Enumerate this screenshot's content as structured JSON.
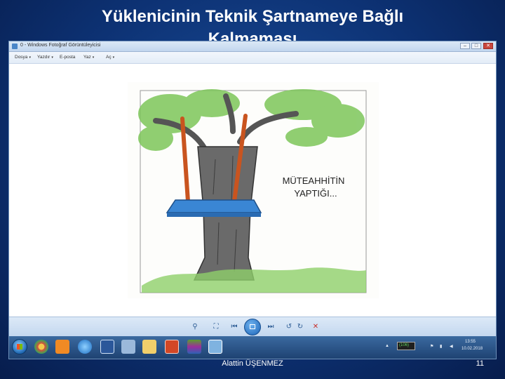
{
  "slide": {
    "title_line1": "Yüklenicinin Teknik Şartnameye Bağlı",
    "title_line2": "Kalmaması",
    "author": "Alattin ÜŞENMEZ",
    "page_number": "11"
  },
  "window": {
    "title": "0 - Windows Fotoğraf Görüntüleyicisi",
    "minimize": "–",
    "maximize": "□",
    "close": "✕"
  },
  "menu": {
    "items": [
      {
        "label": "Dosya",
        "caret": "▾"
      },
      {
        "label": "Yazdır",
        "caret": "▾"
      },
      {
        "label": "E-posta",
        "caret": ""
      },
      {
        "label": "Yaz",
        "caret": "▾"
      },
      {
        "label": "Aç",
        "caret": "▾"
      }
    ]
  },
  "cartoon": {
    "caption_line1": "MÜTEAHHİTİN",
    "caption_line2": "YAPTIĞI..."
  },
  "controls": {
    "zoom": "⚲",
    "fit": "⛶",
    "prev": "⏮",
    "next": "⏭",
    "rotate_left": "↺",
    "rotate_right": "↻",
    "delete": "✕"
  },
  "taskbar": {
    "battery_label": "(106)",
    "clock_time": "13:55",
    "clock_date": "10.02.2018"
  },
  "colors": {
    "background": "#0d3274",
    "swing_seat": "#3a86d4",
    "tree_trunk": "#555555",
    "foliage": "#6cbf4a"
  }
}
